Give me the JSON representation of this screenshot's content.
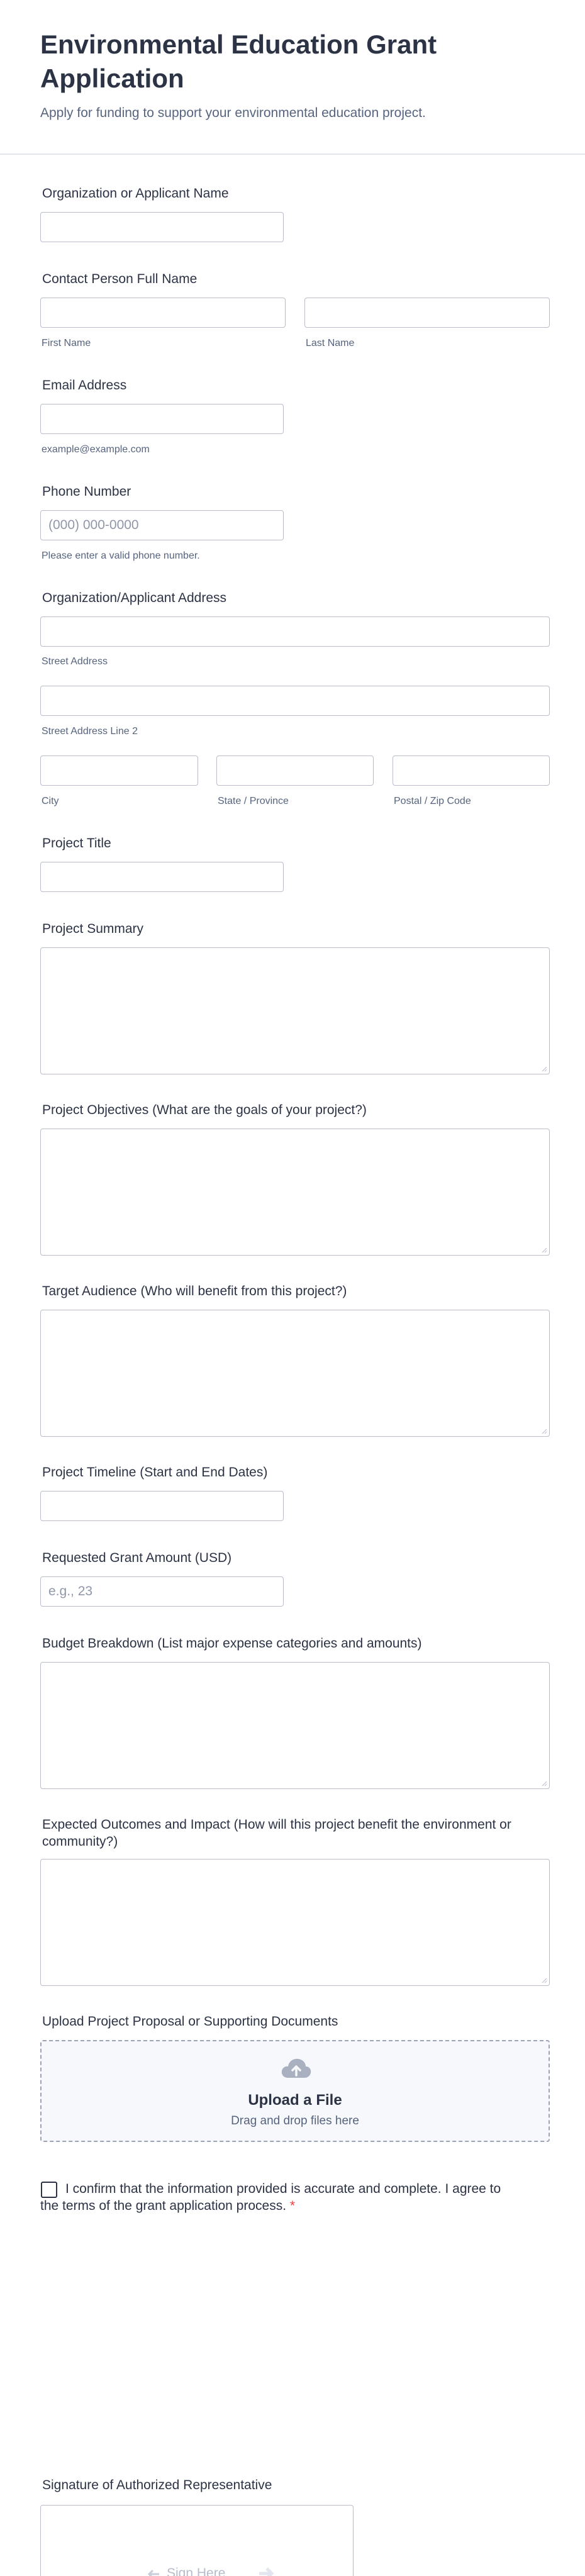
{
  "header": {
    "title": "Environmental Education Grant Application",
    "subtitle": "Apply for funding to support your environmental education project."
  },
  "org_name": {
    "label": "Organization or Applicant Name",
    "value": ""
  },
  "contact": {
    "label": "Contact Person Full Name",
    "first_sub": "First Name",
    "last_sub": "Last Name"
  },
  "email": {
    "label": "Email Address",
    "sub": "example@example.com"
  },
  "phone": {
    "label": "Phone Number",
    "placeholder": "(000) 000-0000",
    "sub": "Please enter a valid phone number."
  },
  "address": {
    "label": "Organization/Applicant Address",
    "street_sub": "Street Address",
    "street2_sub": "Street Address Line 2",
    "city_sub": "City",
    "state_sub": "State / Province",
    "zip_sub": "Postal / Zip Code"
  },
  "project_title": {
    "label": "Project Title"
  },
  "project_summary": {
    "label": "Project Summary"
  },
  "objectives": {
    "label": "Project Objectives (What are the goals of your project?)"
  },
  "audience": {
    "label": "Target Audience (Who will benefit from this project?)"
  },
  "timeline": {
    "label": "Project Timeline (Start and End Dates)"
  },
  "amount": {
    "label": "Requested Grant Amount (USD)",
    "placeholder": "e.g., 23"
  },
  "budget": {
    "label": "Budget Breakdown (List major expense categories and amounts)"
  },
  "outcomes": {
    "label": "Expected Outcomes and Impact (How will this project benefit the environment or community?)"
  },
  "upload": {
    "label": "Upload Project Proposal or Supporting Documents",
    "title": "Upload a File",
    "hint": "Drag and drop files here",
    "icon": "cloud-upload-icon"
  },
  "confirm": {
    "text": "I confirm that the information provided is accurate and complete. I agree to the terms of the grant application process.",
    "required_mark": "*"
  },
  "signature": {
    "label": "Signature of Authorized Representative",
    "hint": "Sign Here"
  },
  "colors": {
    "text": "#2c3345",
    "muted": "#57647e",
    "border": "#b8bdc9",
    "required": "#f23a3c"
  }
}
